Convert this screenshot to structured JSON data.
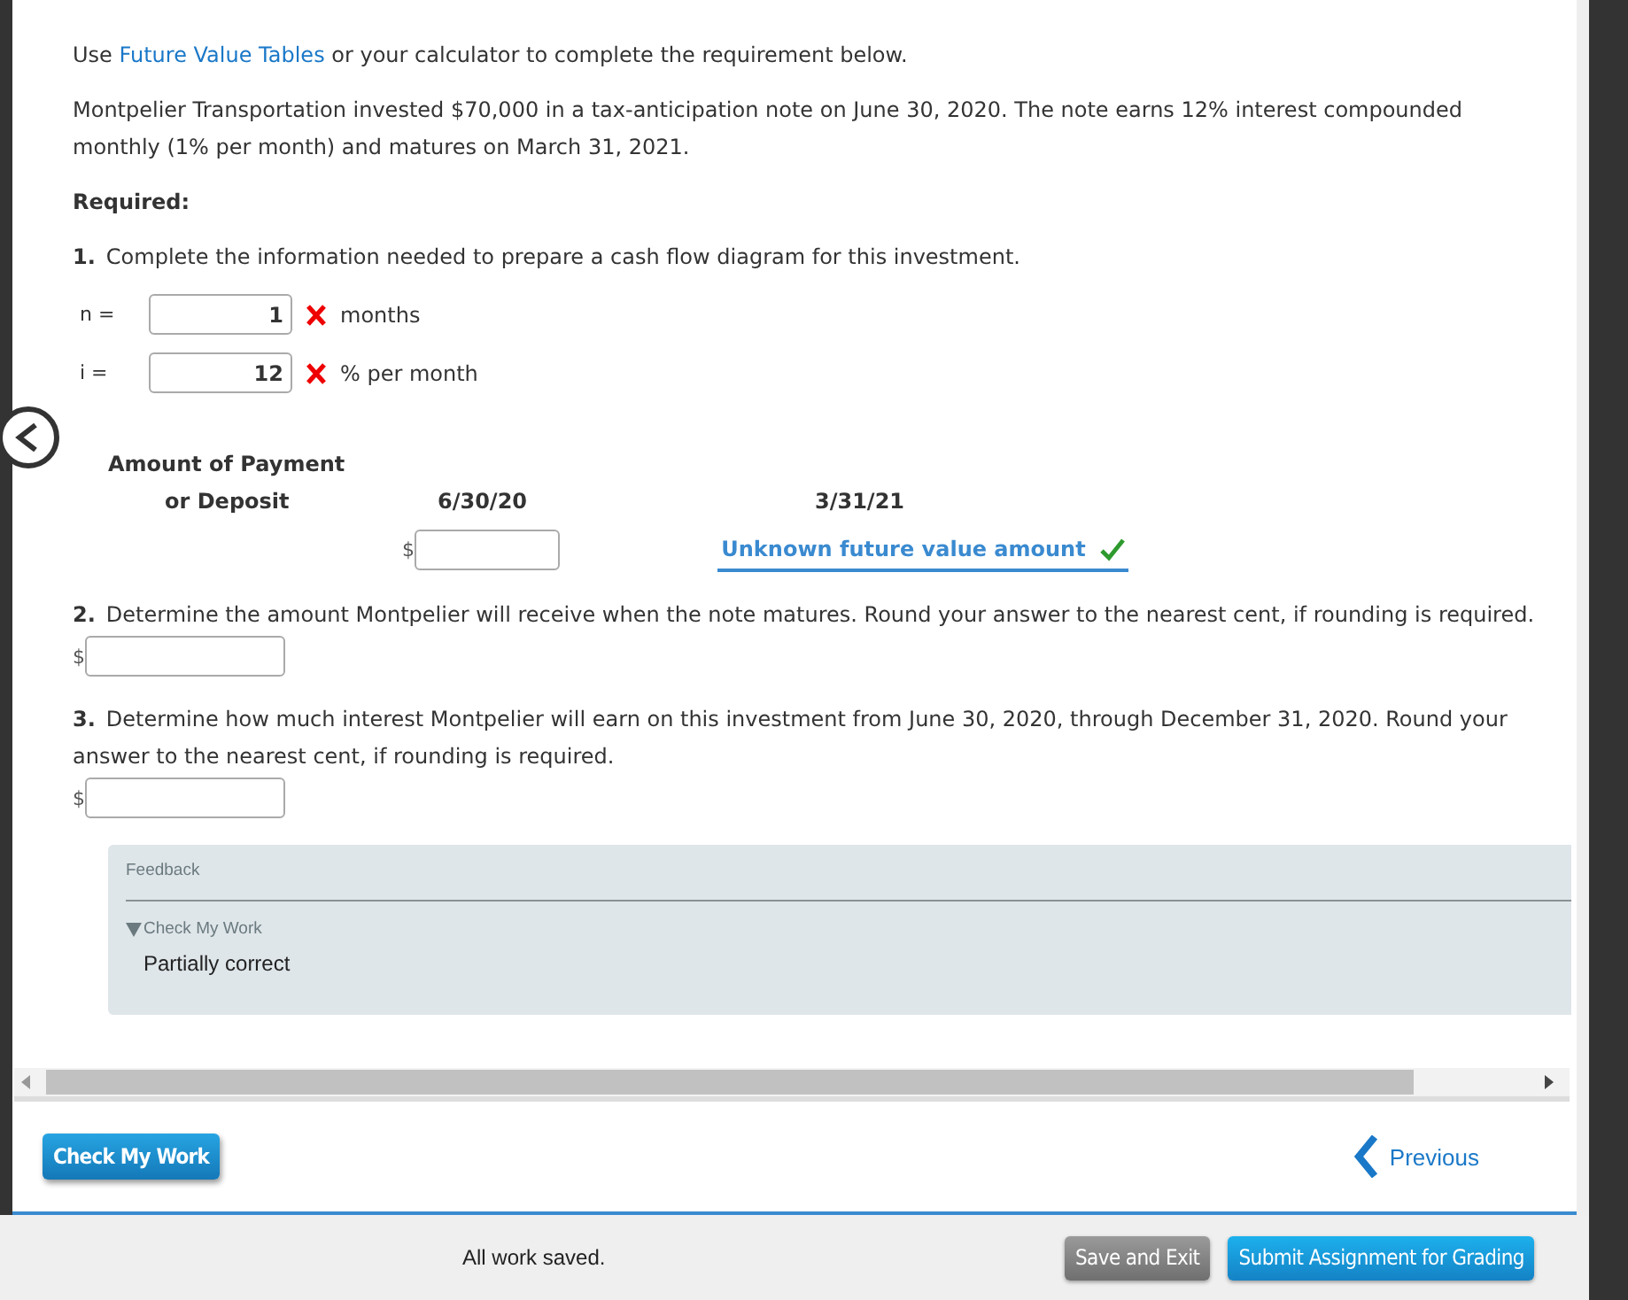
{
  "intro": {
    "before": "Use ",
    "link": "Future Value Tables",
    "after": " or your calculator to complete the requirement below."
  },
  "problem": "Montpelier Transportation invested $70,000 in a tax-anticipation note on June 30, 2020. The note earns 12% interest compounded monthly (1% per month) and matures on March 31, 2021.",
  "required_label": "Required:",
  "part1": {
    "number": "1.",
    "text": "Complete the information needed to prepare a cash flow diagram for this investment.",
    "fields": [
      {
        "label": "n =",
        "value": "1",
        "unit": "months",
        "correct": false
      },
      {
        "label": "i =",
        "value": "12",
        "unit": "% per month",
        "correct": false
      }
    ]
  },
  "diagram": {
    "amount_label": "Amount of Payment",
    "amount_label_2": "or Deposit",
    "dates": [
      "6/30/20",
      "3/31/21"
    ],
    "currency": "$",
    "answer": "Unknown future value amount",
    "answer_correct": true
  },
  "part2": {
    "number": "2.",
    "text": "Determine the amount Montpelier will receive when the note matures. Round your answer to the nearest cent, if rounding is required.",
    "currency": "$"
  },
  "part3": {
    "number": "3.",
    "text": "Determine how much interest Montpelier will earn on this investment from June 30, 2020, through December 31, 2020. Round your answer to the nearest cent, if rounding is required.",
    "currency": "$"
  },
  "feedback": {
    "title": "Feedback",
    "section": "Check My Work",
    "expanded": true,
    "result": "Partially correct"
  },
  "check_button": "Check My Work",
  "previous": "Previous",
  "status": "All work saved.",
  "footer_buttons": [
    {
      "label": "Save and Exit",
      "kind": "secondary"
    },
    {
      "label": "Submit Assignment for Grading",
      "kind": "primary"
    }
  ]
}
